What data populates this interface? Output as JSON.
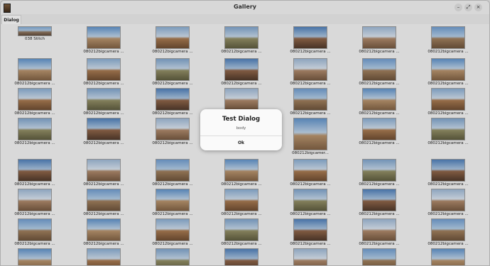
{
  "window": {
    "title": "Gallery"
  },
  "window_controls": {
    "minimize": "–",
    "maximize": "⤢",
    "close": "×"
  },
  "tabs": [
    {
      "label": "Dialog"
    }
  ],
  "gallery": {
    "stitch_label": "038 Stitch",
    "thumb_label": "080212bigcamera ...",
    "row4_col5_label": "080212bigcamer..."
  },
  "dialog": {
    "title": "Test Dialog",
    "body": "body",
    "ok_label": "Ok"
  }
}
